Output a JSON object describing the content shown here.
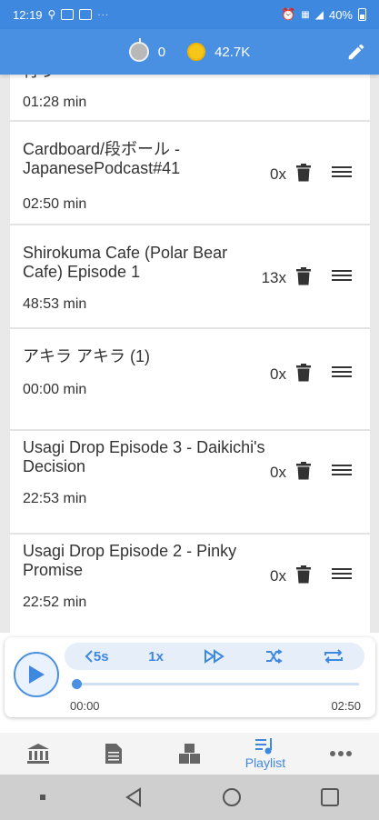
{
  "status_bar": {
    "time": "12:19",
    "battery": "40%"
  },
  "header": {
    "apples": "0",
    "coins": "42.7K"
  },
  "playlist": {
    "partial_item": {
      "title": "行う",
      "duration": "01:28 min"
    },
    "items": [
      {
        "title": "Cardboard/段ボール - JapanesePodcast#41",
        "plays": "0x",
        "duration": "02:50 min"
      },
      {
        "title": "Shirokuma Cafe (Polar Bear Cafe) Episode 1",
        "plays": "13x",
        "duration": "48:53 min"
      },
      {
        "title": "アキラ アキラ (1)",
        "plays": "0x",
        "duration": "00:00 min"
      },
      {
        "title": "Usagi Drop Episode 3 - Daikichi's Decision",
        "plays": "0x",
        "duration": "22:53 min"
      },
      {
        "title": "Usagi Drop Episode 2 - Pinky Promise",
        "plays": "0x",
        "duration": "22:52 min"
      }
    ]
  },
  "player": {
    "rewind": "5s",
    "speed": "1x",
    "elapsed": "00:00",
    "total": "02:50",
    "progress_fraction": 0.0
  },
  "bottom_nav": {
    "playlist_label": "Playlist"
  },
  "colors": {
    "accent": "#4a90e2",
    "coin": "#f5c518"
  }
}
